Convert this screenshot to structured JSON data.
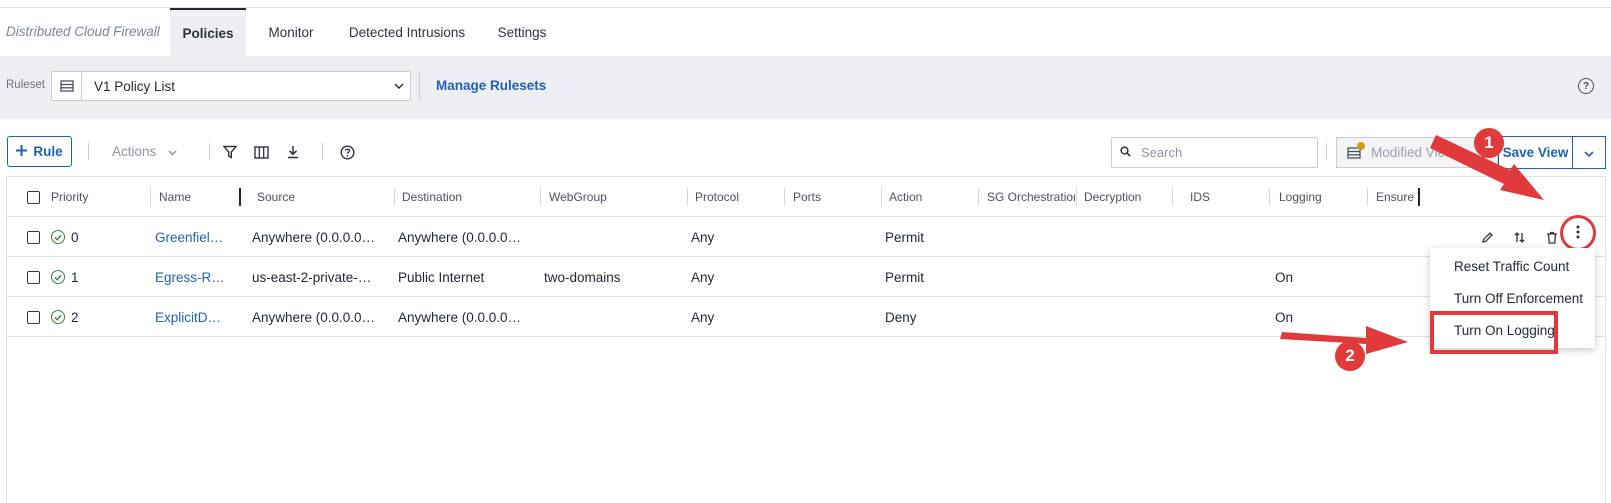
{
  "app": {
    "title": "Distributed Cloud Firewall"
  },
  "tabs": [
    {
      "label": "Policies",
      "active": true
    },
    {
      "label": "Monitor",
      "active": false
    },
    {
      "label": "Detected Intrusions",
      "active": false
    },
    {
      "label": "Settings",
      "active": false
    }
  ],
  "ruleset": {
    "label": "Ruleset",
    "selected": "V1 Policy List",
    "manage_label": "Manage Rulesets",
    "help_glyph": "?"
  },
  "toolbar": {
    "add_rule_label": "Rule",
    "actions_label": "Actions",
    "search_placeholder": "Search",
    "view_label": "Modified View",
    "save_view_label": "Save View"
  },
  "table": {
    "columns": [
      "Priority",
      "Name",
      "Source",
      "Destination",
      "WebGroup",
      "Protocol",
      "Ports",
      "Action",
      "SG Orchestration",
      "Decryption",
      "IDS",
      "Logging",
      "Ensure T"
    ],
    "rows": [
      {
        "priority": "0",
        "name": "Greenfiel…",
        "source": "Anywhere (0.0.0.0…",
        "destination": "Anywhere (0.0.0.0…",
        "webgroup": "",
        "protocol": "Any",
        "ports": "",
        "action": "Permit",
        "logging": ""
      },
      {
        "priority": "1",
        "name": "Egress-R…",
        "source": "us-east-2-private-…",
        "destination": "Public Internet",
        "webgroup": "two-domains",
        "protocol": "Any",
        "ports": "",
        "action": "Permit",
        "logging": "On"
      },
      {
        "priority": "2",
        "name": "ExplicitD…",
        "source": "Anywhere (0.0.0.0…",
        "destination": "Anywhere (0.0.0.0…",
        "webgroup": "",
        "protocol": "Any",
        "ports": "",
        "action": "Deny",
        "logging": "On"
      }
    ]
  },
  "row_menu": {
    "items": [
      "Reset Traffic Count",
      "Turn Off Enforcement",
      "Turn On Logging"
    ],
    "highlighted": "Turn On Logging"
  },
  "annotations": {
    "step1": "1",
    "step2": "2",
    "color": "#e03a3a"
  },
  "colors": {
    "accent": "#1d62b8",
    "status_ok": "#2e8540",
    "band_bg": "#edeff3"
  },
  "icons": [
    "ruleset-list-icon",
    "chevron-down-icon",
    "plus-icon",
    "filter-icon",
    "columns-icon",
    "download-icon",
    "help-icon",
    "search-icon",
    "view-icon",
    "check-circle-icon",
    "edit-icon",
    "reorder-icon",
    "delete-icon",
    "kebab-icon"
  ]
}
